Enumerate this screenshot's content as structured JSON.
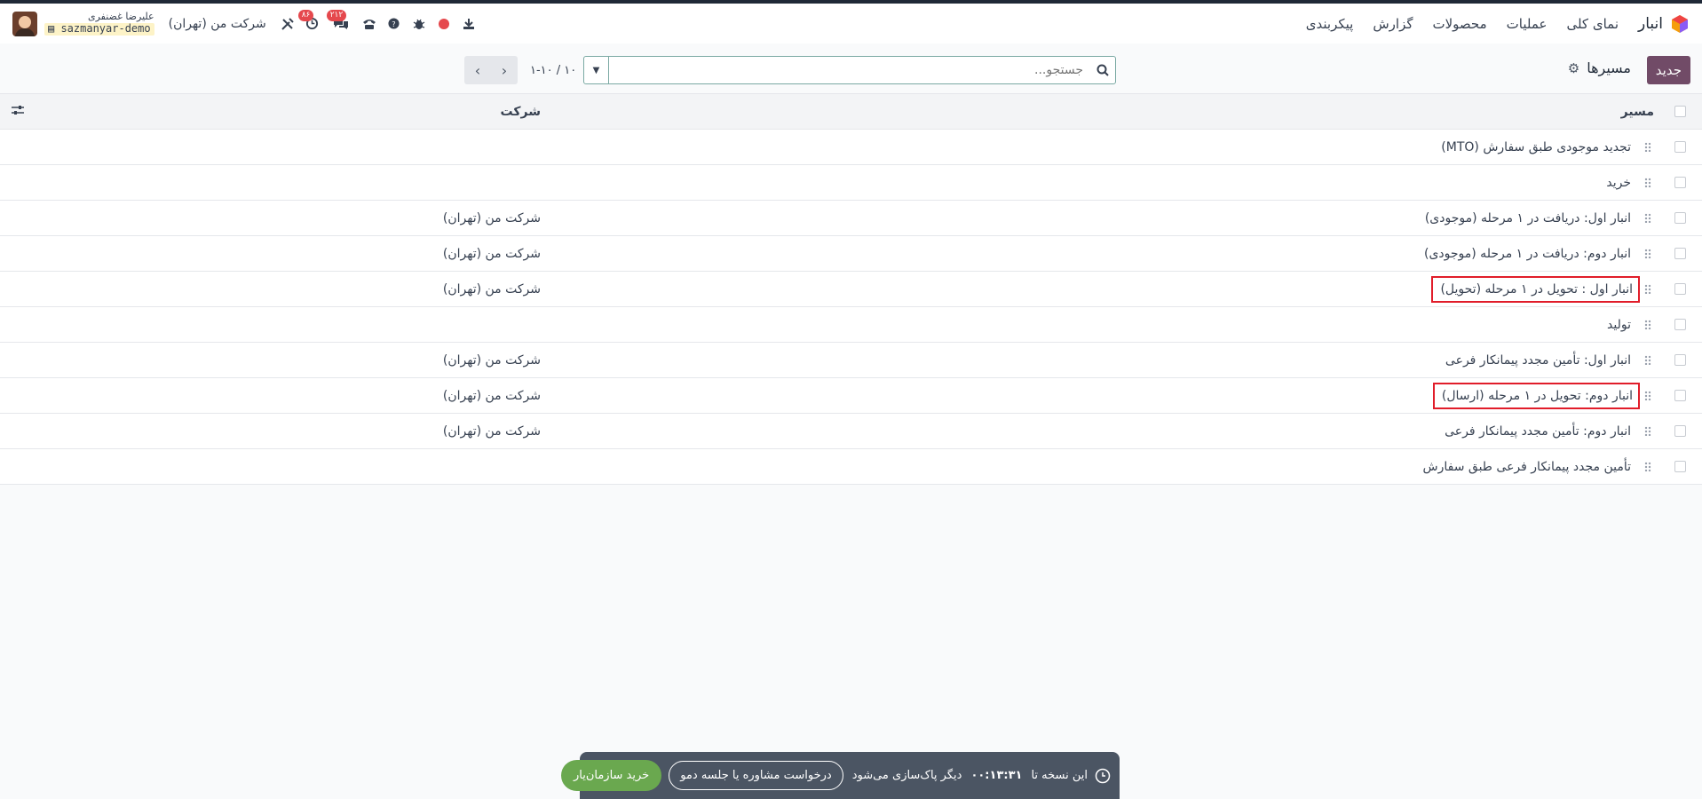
{
  "navbar": {
    "app_name": "انبار",
    "menu": [
      "نمای کلی",
      "عملیات",
      "محصولات",
      "گزارش",
      "پیکربندی"
    ],
    "user_name": "علیرضا غضنفری",
    "database": "sazmanyar-demo",
    "company": "شرکت من (تهران)",
    "activity_count": "۸۶",
    "messages_count": "۲۱۲",
    "icons": [
      "download-icon",
      "record-icon",
      "bug-icon",
      "help-icon",
      "phone-icon",
      "chat-icon",
      "clock-icon",
      "settings-tools-icon"
    ]
  },
  "control_panel": {
    "new_button": "جدید",
    "breadcrumb": "مسیرها",
    "search_placeholder": "جستجو...",
    "pager_value": "۱-۱۰ / ۱۰"
  },
  "table": {
    "columns": {
      "name": "مسیر",
      "company": "شرکت"
    },
    "rows": [
      {
        "name": "تجدید موجودی طبق سفارش (MTO)",
        "company": ""
      },
      {
        "name": "خرید",
        "company": ""
      },
      {
        "name": "انبار اول: دریافت در ۱ مرحله (موجودی)",
        "company": "شرکت من (تهران)"
      },
      {
        "name": "انبار دوم: دریافت در ۱ مرحله (موجودی)",
        "company": "شرکت من (تهران)"
      },
      {
        "name": "انبار اول : تحویل در ۱ مرحله (تحویل)",
        "company": "شرکت من (تهران)",
        "highlighted": true
      },
      {
        "name": "تولید",
        "company": ""
      },
      {
        "name": "انبار اول: تأمین مجدد پیمانکار فرعی",
        "company": "شرکت من (تهران)"
      },
      {
        "name": "انبار دوم: تحویل در ۱ مرحله (ارسال)",
        "company": "شرکت من (تهران)",
        "highlighted": true
      },
      {
        "name": "انبار دوم: تأمین مجدد پیمانکار فرعی",
        "company": "شرکت من (تهران)"
      },
      {
        "name": "تأمین مجدد پیمانکار فرعی طبق سفارش",
        "company": ""
      }
    ]
  },
  "promo": {
    "prefix": "این نسخه تا",
    "time": "۰۰:۱۳:۳۱",
    "suffix": "دیگر پاک‌سازی می‌شود",
    "consult_button": "درخواست مشاوره یا جلسه دمو",
    "buy_button": "خرید سازمان‌یار"
  },
  "colors": {
    "brand": "#714b67",
    "highlight_box": "#e11d2a",
    "promo_bg": "#4b5563",
    "promo_buy": "#6aa84f"
  }
}
